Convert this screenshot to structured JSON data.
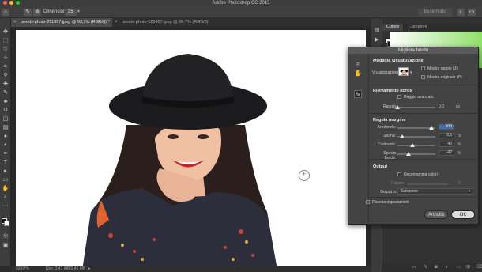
{
  "app": {
    "title": "Adobe Photoshop CC 2015"
  },
  "options_bar": {
    "size_label": "Dimensione:",
    "size_value": "35",
    "workspace": "Essentials"
  },
  "doc_tabs": [
    {
      "label": "pexels-photo-211997.jpeg @ 93,1% (RGB/8) *",
      "close": "×"
    },
    {
      "label": "pexels-photo-125457.jpeg @ 66,7% (RGB/8)",
      "close": "×"
    }
  ],
  "status": {
    "zoom": "93,07%",
    "doc": "Doc: 2,41 MB/2,41 MB"
  },
  "right_panel": {
    "tabs": [
      "Colore",
      "Campioni"
    ]
  },
  "dialog": {
    "title": "Migliora bordo",
    "view": {
      "title": "Modalità visualizzazione",
      "label": "Visualizzazione:",
      "show_radius": "Mostra raggio (J)",
      "show_original": "Mostra originale (P)"
    },
    "edge_detection": {
      "title": "Rilevamento bordo",
      "smart_radius": "Raggio avanzato",
      "radius_label": "Raggio:",
      "radius_value": "0,0",
      "radius_unit": "px"
    },
    "adjust_edge": {
      "title": "Regola margine",
      "rows": [
        {
          "label": "Arrotonda:",
          "value": "100",
          "unit": "",
          "level": 0.9,
          "highlight": true
        },
        {
          "label": "Sfuma:",
          "value": "3,5",
          "unit": "px",
          "level": 0.12,
          "highlight": false
        },
        {
          "label": "Contrasto:",
          "value": "40",
          "unit": "%",
          "level": 0.4,
          "highlight": false
        },
        {
          "label": "Sposta bordo:",
          "value": "-42",
          "unit": "%",
          "level": 0.29,
          "highlight": false
        }
      ]
    },
    "output": {
      "title": "Output",
      "decontaminate": "Decontamina colori",
      "amount_label": "Fattore:",
      "amount_unit": "%",
      "output_to_label": "Output in:",
      "output_to_value": "Selezione"
    },
    "remember": "Ricorda impostazioni",
    "cancel": "Annulla",
    "ok": "OK"
  },
  "colors": {
    "accent_blue": "#3f6fb0",
    "picker_green": "#8fe06a"
  }
}
